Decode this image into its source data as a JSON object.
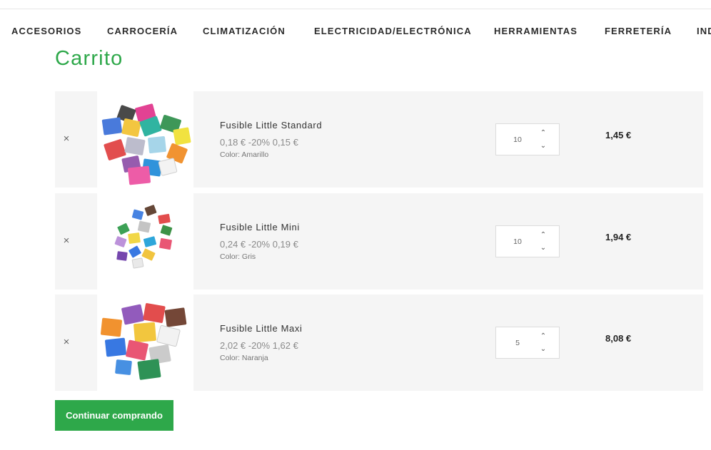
{
  "nav": {
    "items": [
      {
        "label": "ACCESORIOS"
      },
      {
        "label": "CARROCERÍA"
      },
      {
        "label": "CLIMATIZACIÓN"
      },
      {
        "label": "ELECTRICIDAD/ELECTRÓNICA"
      },
      {
        "label": "HERRAMIENTAS"
      },
      {
        "label": "FERRETERÍA"
      },
      {
        "label": "IND"
      }
    ]
  },
  "page": {
    "title": "Carrito"
  },
  "cart": {
    "remove_symbol": "×",
    "qty_up_symbol": "⌃",
    "qty_down_symbol": "⌄",
    "items": [
      {
        "name": "Fusible Little Standard",
        "price_text": "0,18 € -20% 0,15 €",
        "color_text": "Color: Amarillo",
        "quantity": "10",
        "line_total": "1,45 €",
        "image_icon": "fuse-standard-image"
      },
      {
        "name": "Fusible Little Mini",
        "price_text": "0,24 € -20% 0,19 €",
        "color_text": "Color: Gris",
        "quantity": "10",
        "line_total": "1,94 €",
        "image_icon": "fuse-mini-image"
      },
      {
        "name": "Fusible Little Maxi",
        "price_text": "2,02 € -20% 1,62 €",
        "color_text": "Color: Naranja",
        "quantity": "5",
        "line_total": "8,08 €",
        "image_icon": "fuse-maxi-image"
      }
    ]
  },
  "actions": {
    "continue_label": "Continuar comprando"
  },
  "colors": {
    "accent": "#2ea84a",
    "row_background": "#f5f5f5"
  }
}
